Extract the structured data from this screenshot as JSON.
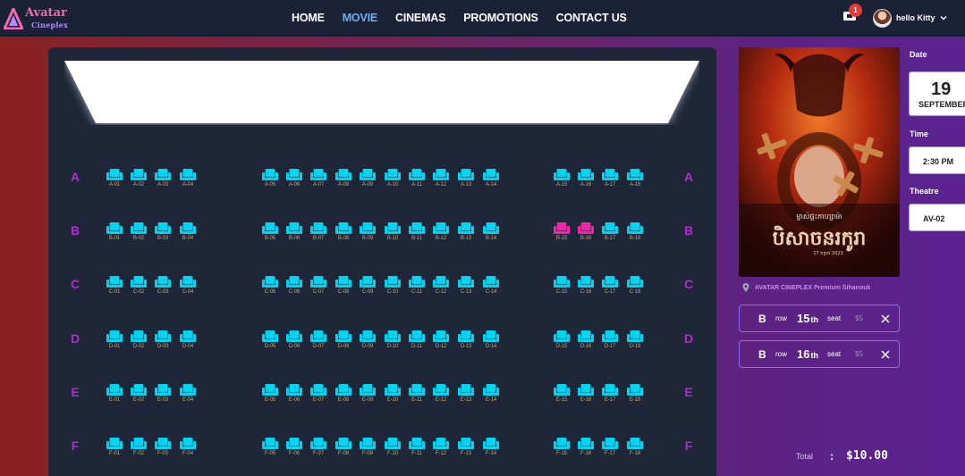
{
  "brand": {
    "name": "Avatar",
    "sub": "Cineplex"
  },
  "nav": {
    "links": [
      {
        "label": "HOME",
        "active": false
      },
      {
        "label": "MOVIE",
        "active": true
      },
      {
        "label": "CINEMAS",
        "active": false
      },
      {
        "label": "PROMOTIONS",
        "active": false
      },
      {
        "label": "CONTACT US",
        "active": false
      }
    ],
    "cart_count": "1",
    "user_name": "hello Kitty"
  },
  "seatmap": {
    "rows": [
      "A",
      "B",
      "C",
      "D",
      "E",
      "F"
    ],
    "columns": 18,
    "selected": [
      "B-15",
      "B-16"
    ],
    "colors": {
      "available": "#00d4f0",
      "selected": "#f026a8",
      "row_label": "#b12ccf",
      "seat_label": "#c7a777"
    }
  },
  "poster": {
    "title_line": "ម្ចាស់ផ្ទះកាហ្សាម៉ា",
    "title_main": "បិសាចនរកូរា",
    "date_line": "17 កក្កដា 2023"
  },
  "location": "AVATAR CINEPLEX Premium Sihanouk",
  "tickets": [
    {
      "row": "B",
      "row_word": "row",
      "num": "15",
      "suffix": "th",
      "seat_word": "seat",
      "price": "$5"
    },
    {
      "row": "B",
      "row_word": "row",
      "num": "16",
      "suffix": "th",
      "seat_word": "seat",
      "price": "$5"
    }
  ],
  "total": {
    "label": "Total",
    "colon": ":",
    "value": "$10.00"
  },
  "booking": {
    "date_label": "Date",
    "date_day": "19",
    "date_month": "SEPTEMBER",
    "time_label": "Time",
    "time_value": "2:30 PM",
    "theatre_label": "Theatre",
    "theatre_value": "AV-02"
  }
}
